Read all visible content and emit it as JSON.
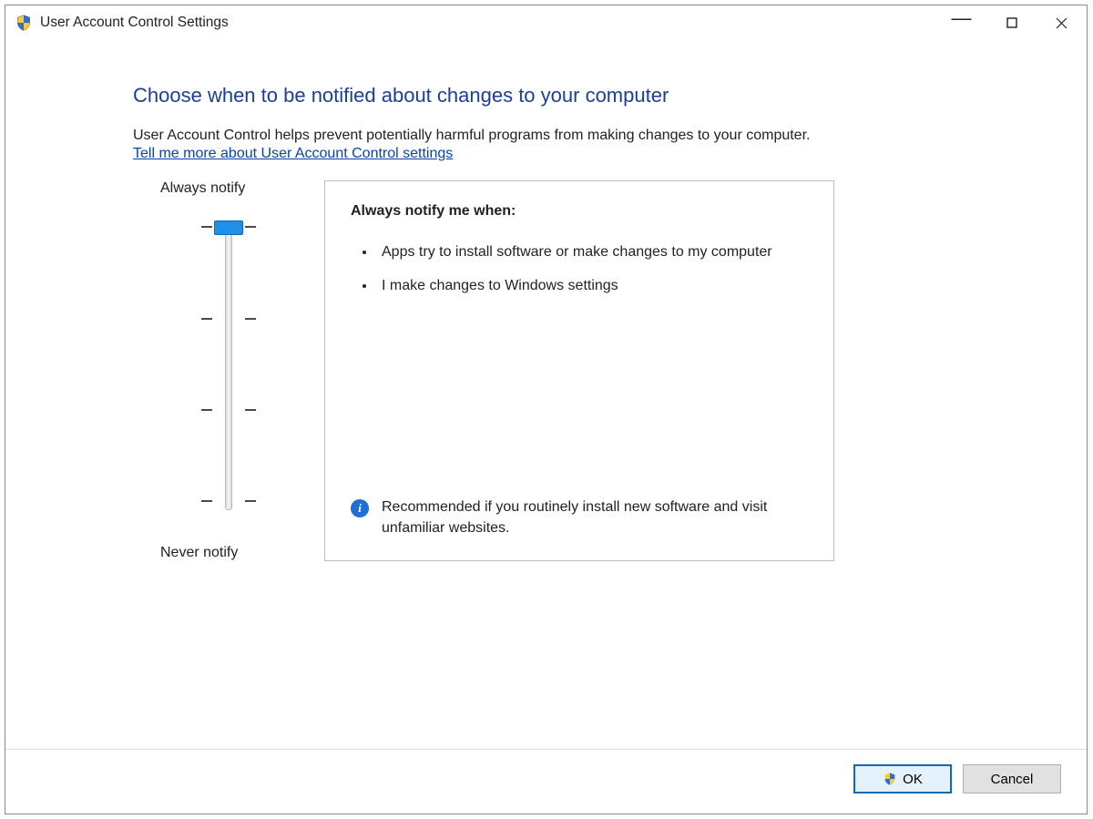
{
  "window": {
    "title": "User Account Control Settings"
  },
  "main": {
    "heading": "Choose when to be notified about changes to your computer",
    "description": "User Account Control helps prevent potentially harmful programs from making changes to your computer.",
    "help_link": "Tell me more about User Account Control settings"
  },
  "slider": {
    "top_label": "Always notify",
    "bottom_label": "Never notify",
    "positions": 4,
    "current_position": 0
  },
  "pane": {
    "title": "Always notify me when:",
    "bullets": [
      "Apps try to install software or make changes to my computer",
      "I make changes to Windows settings"
    ],
    "recommendation": "Recommended if you routinely install new software and visit unfamiliar websites."
  },
  "footer": {
    "ok_label": "OK",
    "cancel_label": "Cancel"
  }
}
